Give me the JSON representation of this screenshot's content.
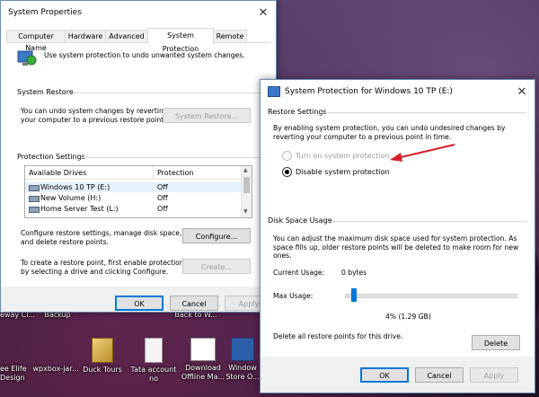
{
  "desktop": {
    "partial_labels": [
      "eway Cl...",
      "Backup",
      "Back to W..."
    ],
    "icons": [
      {
        "label": "ee Elife\nDesign"
      },
      {
        "label": "wpxbox-jar..."
      },
      {
        "label": "Duck Tours"
      },
      {
        "label": "Tata account\nno"
      },
      {
        "label": "Download\nOffline Ma..."
      },
      {
        "label": "Window\nStore O..."
      }
    ]
  },
  "sys_props": {
    "title": "System Properties",
    "tabs": [
      "Computer Name",
      "Hardware",
      "Advanced",
      "System Protection",
      "Remote"
    ],
    "active_tab": "System Protection",
    "intro": "Use system protection to undo unwanted system changes.",
    "restore_heading": "System Restore",
    "restore_text": "You can undo system changes by reverting\nyour computer to a previous restore point.",
    "restore_button": "System Restore...",
    "protection_heading": "Protection Settings",
    "table_headers": [
      "Available Drives",
      "Protection"
    ],
    "drives": [
      {
        "name": "Windows 10 TP (E:)",
        "protection": "Off"
      },
      {
        "name": "New Volume (H:)",
        "protection": "Off"
      },
      {
        "name": "Home Server Test (L:)",
        "protection": "Off"
      }
    ],
    "configure_text": "Configure restore settings, manage disk space,\nand delete restore points.",
    "configure_button": "Configure...",
    "create_text": "To create a restore point, first enable protection\nby selecting a drive and clicking Configure.",
    "create_button": "Create...",
    "ok": "OK",
    "cancel": "Cancel",
    "apply": "Apply"
  },
  "dialog": {
    "title": "System Protection for Windows 10 TP (E:)",
    "restore_settings_heading": "Restore Settings",
    "restore_settings_text": "By enabling system protection, you can undo undesired changes by\nreverting your computer to a previous point in time.",
    "radio_on": "Turn on system protection",
    "radio_off": "Disable system protection",
    "selected_option": "Disable system protection",
    "disk_heading": "Disk Space Usage",
    "disk_text": "You can adjust the maximum disk space used for system protection. As\nspace fills up, older restore points will be deleted to make room for new\nones.",
    "current_usage_label": "Current Usage:",
    "current_usage_value": "0 bytes",
    "max_usage_label": "Max Usage:",
    "max_usage_percent": 4,
    "max_usage_value": "4% (1.29 GB)",
    "delete_text": "Delete all restore points for this drive.",
    "delete_button": "Delete",
    "ok": "OK",
    "cancel": "Cancel",
    "apply": "Apply"
  },
  "colors": {
    "arrow": "#d9202c",
    "accent": "#0078d7"
  }
}
